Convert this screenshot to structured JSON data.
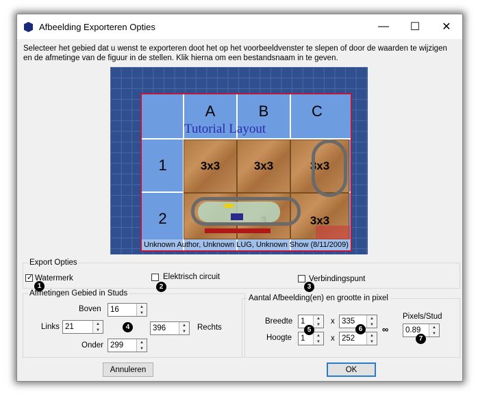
{
  "window": {
    "title": "Afbeelding Exporteren Opties",
    "minimize": "—",
    "maximize": "☐",
    "close": "✕"
  },
  "description": "Selecteer het gebied dat u wenst te exporteren doot het op het voorbeeldvenster te slepen of door de waarden te wijzigen en de afmetinge van de figuur in de stellen. Klik hierna om een bestandsnaam in te geven.",
  "preview": {
    "columns": [
      "A",
      "B",
      "C"
    ],
    "rows": [
      "1",
      "2"
    ],
    "layout_title": "Tutorial Layout",
    "tiles": [
      "3x3",
      "3x3",
      "3x3",
      "3",
      "3x3"
    ],
    "caption": "Unknown Author, Unknown LUG, Unknown Show (8/11/2009)"
  },
  "export_options": {
    "legend": "Export Opties",
    "watermark": {
      "label": "Watermerk",
      "checked": true,
      "badge": "1"
    },
    "electric": {
      "label": "Elektrisch circuit",
      "checked": false,
      "badge": "2"
    },
    "connection": {
      "label": "Verbindingspunt",
      "checked": false,
      "badge": "3"
    }
  },
  "area": {
    "legend": "Afmetingen Gebied in Studs",
    "top_label": "Boven",
    "top_value": "16",
    "left_label": "Links",
    "left_value": "21",
    "right_label": "Rechts",
    "right_value": "396",
    "bottom_label": "Onder",
    "bottom_value": "299",
    "badge": "4"
  },
  "pixels": {
    "legend": "Aantal Afbeelding(en) en grootte in pixel",
    "width_label": "Breedte",
    "width_count": "1",
    "width_px": "335",
    "height_label": "Hoogte",
    "height_count": "1",
    "height_px": "252",
    "times": "x",
    "pps_label": "Pixels/Stud",
    "pps_value": "0.89",
    "badge5": "5",
    "badge6": "6",
    "badge7": "7",
    "link_icon": "link-icon"
  },
  "buttons": {
    "cancel": "Annuleren",
    "ok": "OK"
  }
}
